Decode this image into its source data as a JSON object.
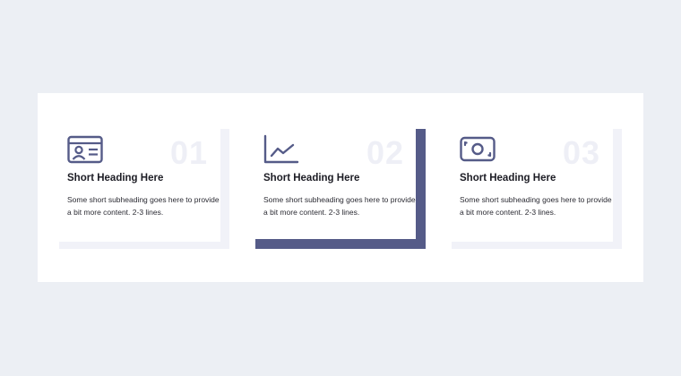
{
  "colors": {
    "background": "#eceff4",
    "panel": "#ffffff",
    "accent": "#555b88",
    "frame_light": "#f1f2f8",
    "number": "#eeeff6"
  },
  "cards": [
    {
      "number": "01",
      "icon": "id-card-icon",
      "heading": "Short Heading Here",
      "subheading": "Some short subheading goes here to provide a bit more content. 2-3 lines.",
      "active": false
    },
    {
      "number": "02",
      "icon": "line-chart-icon",
      "heading": "Short Heading Here",
      "subheading": "Some short subheading goes here to provide a bit more content. 2-3 lines.",
      "active": true
    },
    {
      "number": "03",
      "icon": "banknote-icon",
      "heading": "Short Heading Here",
      "subheading": "Some short subheading goes here to provide a bit more content. 2-3 lines.",
      "active": false
    }
  ]
}
